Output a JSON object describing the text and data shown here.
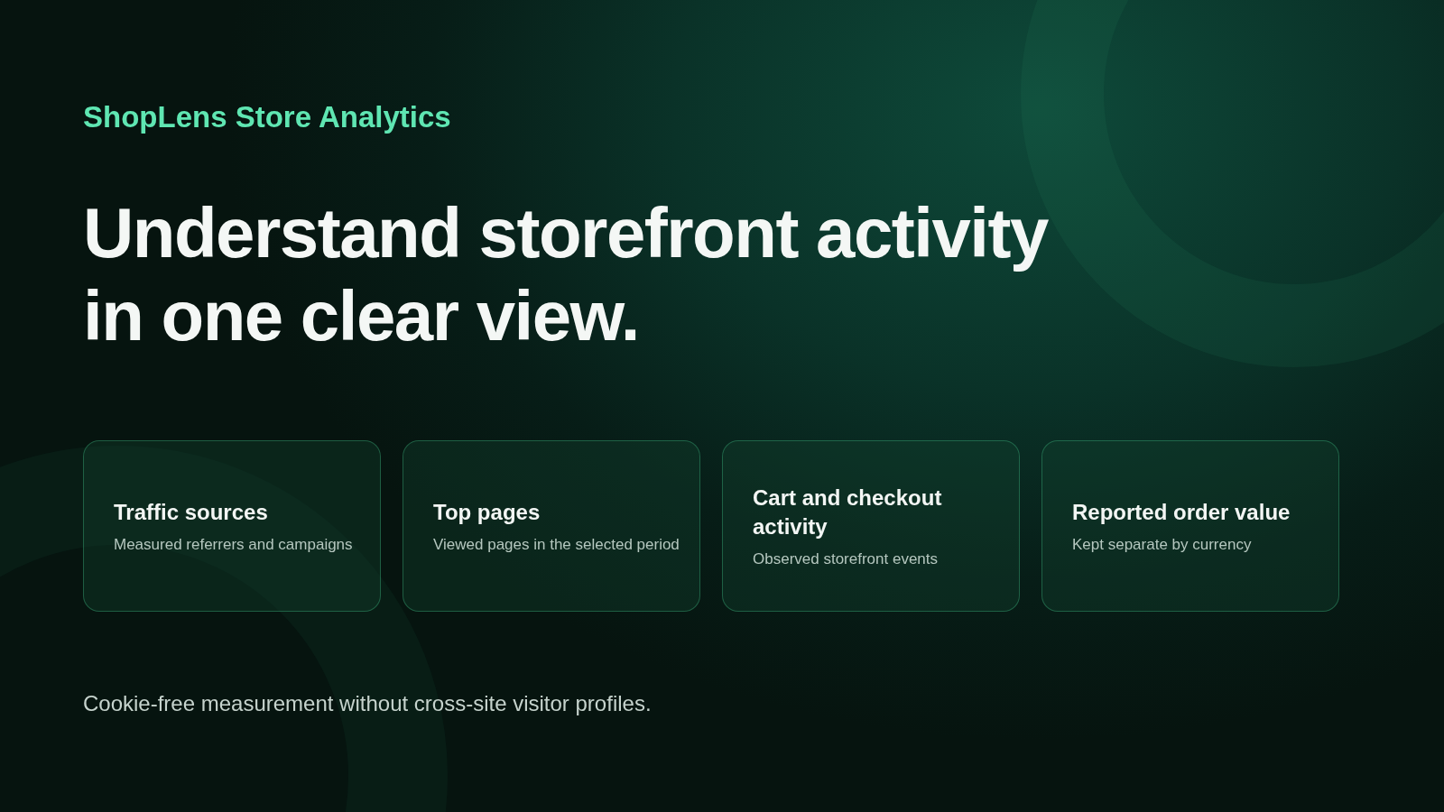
{
  "brand": "ShopLens Store Analytics",
  "headline": [
    "Understand storefront activity",
    "in one clear view."
  ],
  "cards": [
    {
      "title": "Traffic sources",
      "description": "Measured referrers and campaigns"
    },
    {
      "title": "Top pages",
      "description": "Viewed pages in the selected period"
    },
    {
      "title": "Cart and checkout activity",
      "description": "Observed storefront events"
    },
    {
      "title": "Reported order value",
      "description": "Kept separate by currency"
    }
  ],
  "footnote": "Cookie-free measurement without cross-site visitor profiles."
}
